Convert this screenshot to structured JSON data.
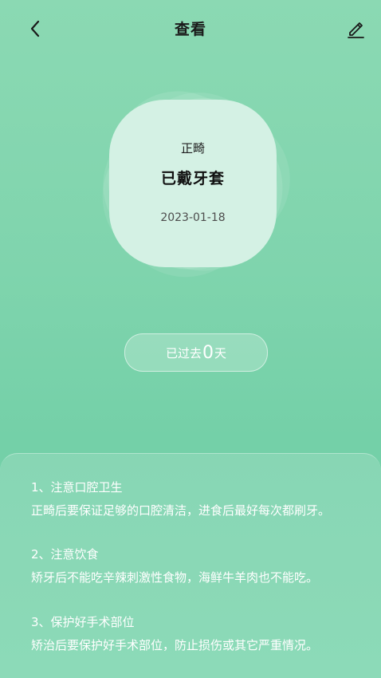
{
  "header": {
    "title": "查看",
    "back_icon": "chevron-left-icon",
    "edit_icon": "pencil-icon"
  },
  "status": {
    "stage": "正畸",
    "label": "已戴牙套",
    "date": "2023-01-18"
  },
  "elapsed": {
    "prefix": "已过去",
    "days": "0",
    "suffix": "天"
  },
  "tips": [
    {
      "title": "1、注意口腔卫生",
      "body": "正畸后要保证足够的口腔清洁，进食后最好每次都刷牙。"
    },
    {
      "title": "2、注意饮食",
      "body": "矫牙后不能吃辛辣刺激性食物，海鲜牛羊肉也不能吃。"
    },
    {
      "title": "3、保护好手术部位",
      "body": "矫治后要保护好手术部位，防止损伤或其它严重情况。"
    }
  ],
  "colors": {
    "background": "#7fd4ad",
    "card": "#d4f1e4",
    "text_on_green": "#ffffff"
  }
}
